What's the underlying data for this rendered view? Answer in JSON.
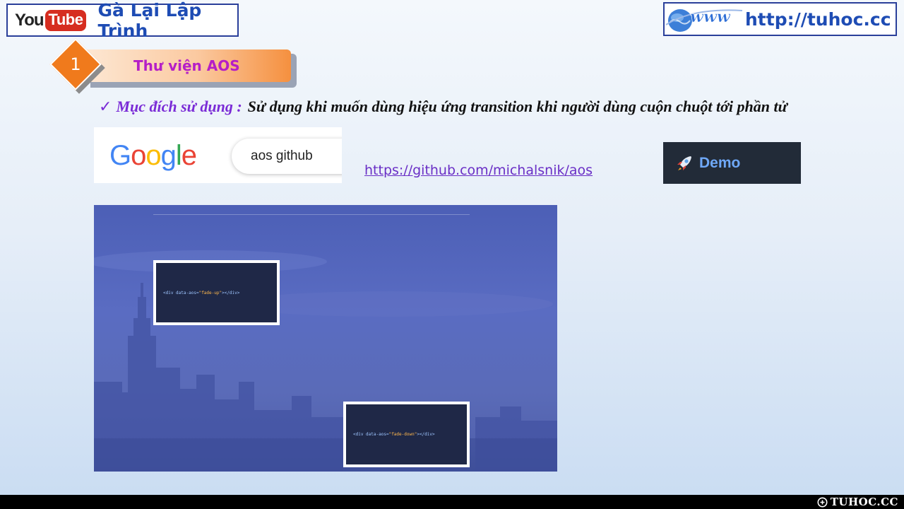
{
  "header": {
    "youtube_you": "You",
    "youtube_tube": "Tube",
    "channel_title": "Gà Lại Lập Trình",
    "www_text": "www",
    "website_url": "http://tuhoc.cc"
  },
  "section": {
    "number": "1",
    "title": "Thư viện AOS"
  },
  "purpose": {
    "check": "✓",
    "label": "Mục đích sử dụng :",
    "text": "Sử dụng khi muốn dùng hiệu ứng transition khi người dùng cuộn chuột tới phần tử"
  },
  "google": {
    "logo": [
      "G",
      "o",
      "o",
      "g",
      "l",
      "e"
    ],
    "logo_colors": [
      "#4285F4",
      "#EA4335",
      "#FBBC05",
      "#4285F4",
      "#34A853",
      "#EA4335"
    ],
    "query": "aos github"
  },
  "link": {
    "url": "https://github.com/michalsnik/aos",
    "color": "#6a2fc6"
  },
  "demo": {
    "icon": "rocket-icon",
    "label": "Demo"
  },
  "preview": {
    "card_up": {
      "prefix": "<div data-aos=",
      "value": "\"fade-up\"",
      "suffix": "></div>"
    },
    "card_down": {
      "prefix": "<div data-aos=",
      "value": "\"fade-down\"",
      "suffix": "></div>"
    }
  },
  "watermark": {
    "icon": "tuhoc-logo-icon",
    "text": "TUHOC.CC"
  }
}
